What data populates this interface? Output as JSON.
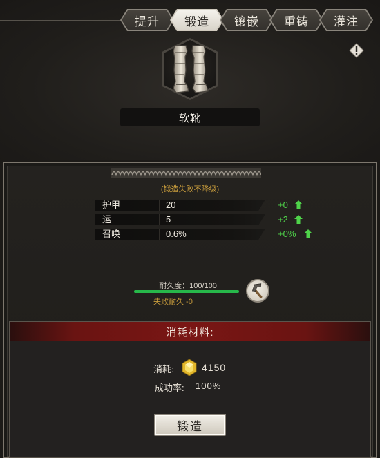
{
  "tabs": [
    {
      "label": "提升",
      "active": false
    },
    {
      "label": "锻造",
      "active": true
    },
    {
      "label": "镶嵌",
      "active": false
    },
    {
      "label": "重铸",
      "active": false
    },
    {
      "label": "灌注",
      "active": false
    }
  ],
  "item": {
    "name": "软靴",
    "icon": "leather-boots-icon"
  },
  "info_icon": "exclamation-diamond-icon",
  "note": "(锻造失败不降级)",
  "stats": [
    {
      "name": "护甲",
      "value": "20",
      "bonus": "+0"
    },
    {
      "name": "运",
      "value": "5",
      "bonus": "+2"
    },
    {
      "name": "召唤",
      "value": "0.6%",
      "bonus": "+0%"
    }
  ],
  "durability": {
    "label": "耐久度：100/100",
    "fraction": 1.0,
    "fail_text": "失败耐久 -0"
  },
  "materials": {
    "header": "消耗材料:",
    "cost_label": "消耗:",
    "cost_value": "4150",
    "cost_icon": "gold-gem-icon",
    "success_label": "成功率:",
    "success_value": "100%"
  },
  "forge_button": "锻造",
  "colors": {
    "bonus": "#4fd34a",
    "note": "#c89c3c",
    "durability_bar": "#27b84a",
    "header_red": "#7a1614"
  }
}
